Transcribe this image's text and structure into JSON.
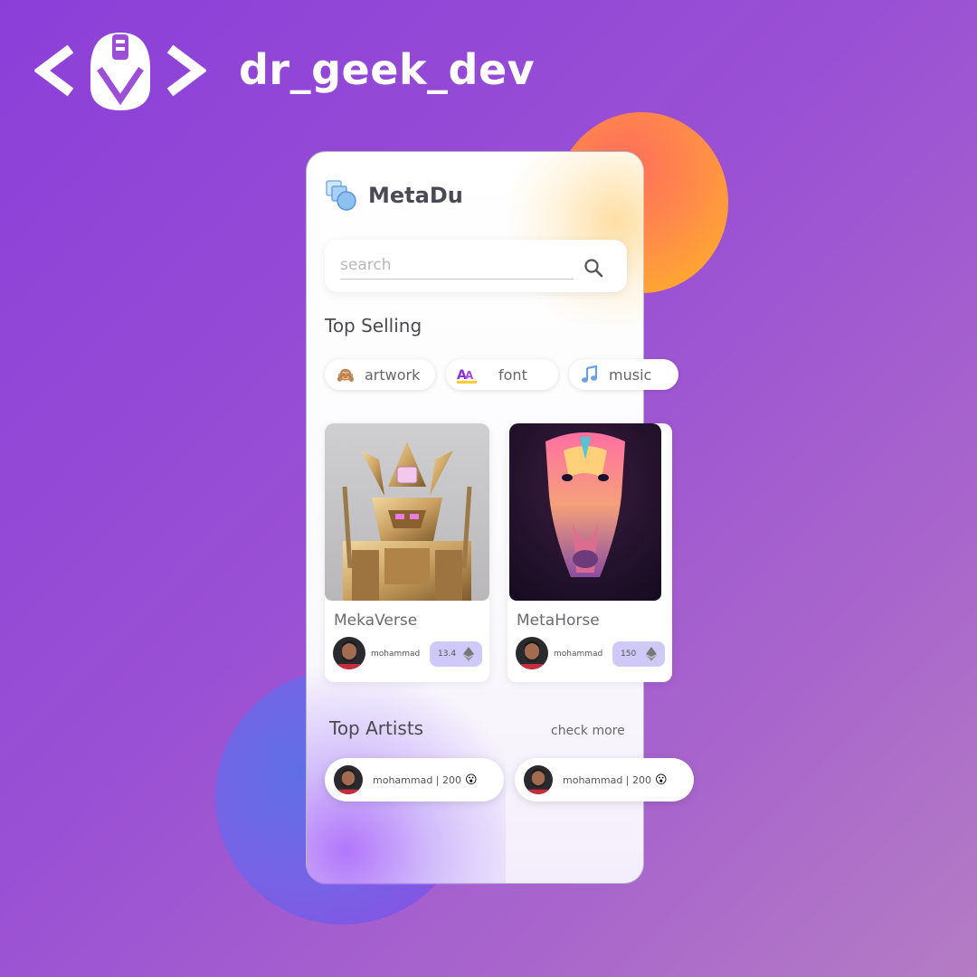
{
  "brand": {
    "name": "dr_geek_dev",
    "colors": {
      "background_start": "#8b3fd9",
      "background_end": "#b47cc4",
      "logo": "#ffffff"
    }
  },
  "app": {
    "title": "MetaDu",
    "search": {
      "placeholder": "search",
      "value": ""
    },
    "top_selling": {
      "title": "Top Selling",
      "categories": [
        {
          "label": "artwork",
          "icon": "see-no-evil-monkey-icon"
        },
        {
          "label": "font",
          "icon": "font-aa-icon"
        },
        {
          "label": "music",
          "icon": "music-note-icon"
        }
      ],
      "items": [
        {
          "name": "MekaVerse",
          "owner": "mohammad",
          "price": "13.4",
          "currency_icon": "ethereum-icon"
        },
        {
          "name": "MetaHorse",
          "owner": "mohammad",
          "price": "150",
          "currency_icon": "ethereum-icon"
        }
      ]
    },
    "top_artists": {
      "title": "Top Artists",
      "check_more": "check more",
      "artists": [
        {
          "label": "mohammad | 200",
          "emoji": "😮"
        },
        {
          "label": "mohammad | 200",
          "emoji": "😮"
        }
      ]
    },
    "colors": {
      "accent_orange": "#ff8a4a",
      "accent_blue": "#6a68e6",
      "price_badge": "#cfc9f7"
    }
  }
}
